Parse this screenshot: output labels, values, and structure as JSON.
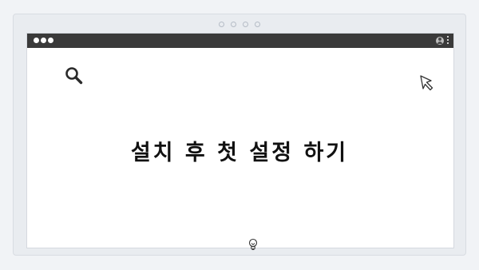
{
  "pager": {
    "dots": 4
  },
  "window": {
    "traffic_lights": 3,
    "title_bar_color": "#3a3a3a",
    "icons": [
      "user-icon",
      "kebab-menu-icon"
    ]
  },
  "content": {
    "headline": "설치 후 첫 설정 하기",
    "icons": [
      "search-icon",
      "cursor-arrow-icon",
      "lightbulb-icon"
    ]
  }
}
